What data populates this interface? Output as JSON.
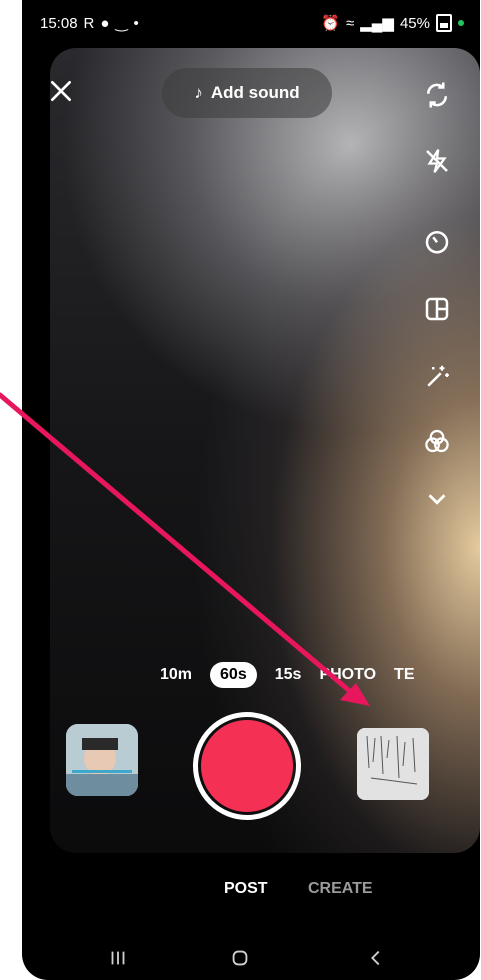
{
  "status_bar": {
    "time": "15:08",
    "left_icons": [
      "R",
      "messenger-icon",
      "minus-icon",
      "dot-icon"
    ],
    "battery": "45%"
  },
  "camera": {
    "add_sound_label": "Add sound",
    "modes": [
      "10m",
      "60s",
      "15s",
      "PHOTO",
      "TE"
    ],
    "active_mode": "60s",
    "tools": [
      "flip-camera-icon",
      "flash-off-icon",
      "timer-icon",
      "layout-icon",
      "magic-wand-icon",
      "filters-icon",
      "chevron-down-icon"
    ],
    "record_color": "#f43155"
  },
  "bottom_tabs": {
    "post": "POST",
    "create": "CREATE"
  },
  "annotation": {
    "arrow_color": "#e8175d"
  }
}
